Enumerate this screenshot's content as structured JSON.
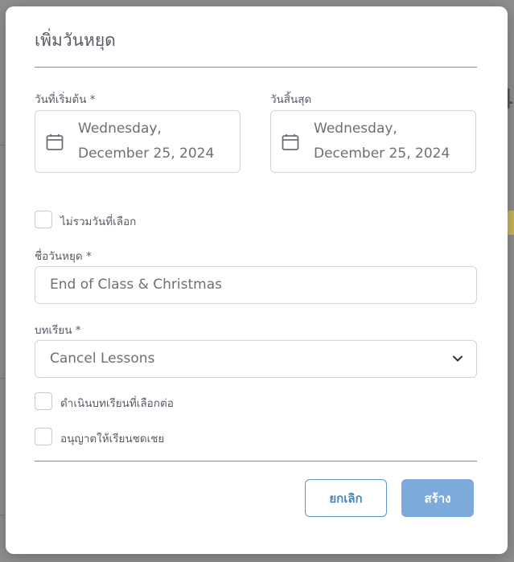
{
  "modal": {
    "title": "เพิ่มวันหยุด",
    "start_date": {
      "label": "วันที่เริ่มต้น *",
      "line1": "Wednesday,",
      "line2": "December 25, 2024"
    },
    "end_date": {
      "label": "วันสิ้นสุด",
      "line1": "Wednesday,",
      "line2": "December 25, 2024"
    },
    "exclude_selected_days": {
      "label": "ไม่รวมวันที่เลือก",
      "checked": false
    },
    "holiday_name": {
      "label": "ชื่อวันหยุด *",
      "value": "End of Class & Christmas"
    },
    "lessons": {
      "label": "บทเรียน *",
      "selected": "Cancel Lessons"
    },
    "continue_lessons": {
      "label": "ดำเนินบทเรียนที่เลือกต่อ",
      "checked": false
    },
    "allow_makeup": {
      "label": "อนุญาตให้เรียนชดเชย",
      "checked": false
    },
    "cancel_label": "ยกเลิก",
    "create_label": "สร้าง"
  },
  "background": {
    "fragment_right": "4",
    "fragment_tag": "e"
  },
  "colors": {
    "primary": "#4a86bf",
    "primary_fill": "#7cabdb",
    "overlay": "#8f8f8f"
  }
}
